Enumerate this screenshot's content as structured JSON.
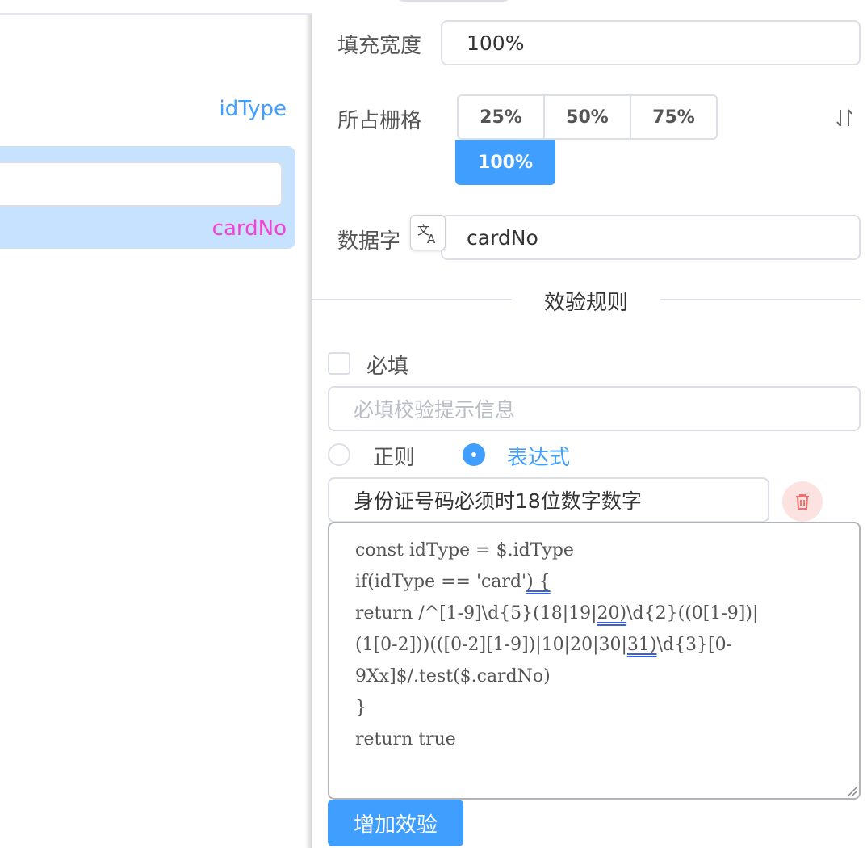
{
  "canvas": {
    "idtype_label": "idType",
    "cardno_label": "cardNo"
  },
  "props": {
    "fill_width": {
      "label": "填充宽度",
      "value": "100%"
    },
    "grid_span": {
      "label": "所占栅格",
      "options": [
        "25%",
        "50%",
        "75%",
        "100%"
      ],
      "selected": "100%"
    },
    "data_field": {
      "label": "数据字段",
      "visible_label": "数据字",
      "value": "cardNo"
    },
    "validation": {
      "section_title": "效验规则",
      "required_label": "必填",
      "required_checked": false,
      "required_message_placeholder": "必填校验提示信息",
      "mode_regex_label": "正则",
      "mode_expression_label": "表达式",
      "selected_mode": "表达式",
      "rule_message": "身份证号码必须时18位数字数字",
      "expression_lines": [
        [
          "const idType = $.idType"
        ],
        [
          "if(idType == 'card'",
          ") {"
        ],
        [
          "return /^[1-9]\\d{5}(18|19|",
          "20)",
          "\\d{2}((0[1-9])|"
        ],
        [
          "(1[0-2]))(([0-2][1-9])|10|20|30|",
          "31)",
          "\\d{3}[0-"
        ],
        [
          "9Xx]$/.test($.cardNo)"
        ],
        [
          "}"
        ],
        [
          "return true"
        ]
      ],
      "add_button_label": "增加效验"
    }
  },
  "colors": {
    "primary": "#409eff",
    "selected_bg": "#c6e2ff",
    "cardno_label": "#f63fd5",
    "danger": "#f56c6c",
    "danger_bg": "#fde2e2"
  },
  "icons": [
    "sort-icon",
    "translate-icon",
    "delete-icon",
    "resize-grip-icon"
  ]
}
